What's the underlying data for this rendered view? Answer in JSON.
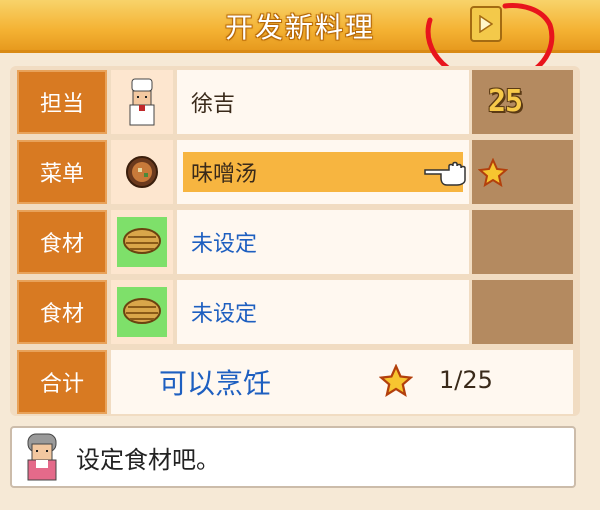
{
  "header": {
    "title": "开发新料理"
  },
  "rows": [
    {
      "label": "担当",
      "value": "徐吉",
      "level": "25",
      "icon": "chef-portrait-icon"
    },
    {
      "label": "菜单",
      "value": "味噌汤",
      "icon": "miso-soup-icon",
      "rating_icon": "star-icon",
      "pointer_icon": "pointing-hand-icon"
    },
    {
      "label": "食材",
      "value": "未设定",
      "icon": "basket-icon"
    },
    {
      "label": "食材",
      "value": "未设定",
      "icon": "basket-icon"
    }
  ],
  "total": {
    "label": "合计",
    "status": "可以烹饪",
    "count": "1/25",
    "icon": "star-icon"
  },
  "message": {
    "text": "设定食材吧。",
    "icon": "assistant-portrait-icon"
  },
  "colors": {
    "accent": "#d87a22",
    "header": "#f4b233",
    "highlight": "#f7b540",
    "link": "#1e5fc0"
  }
}
